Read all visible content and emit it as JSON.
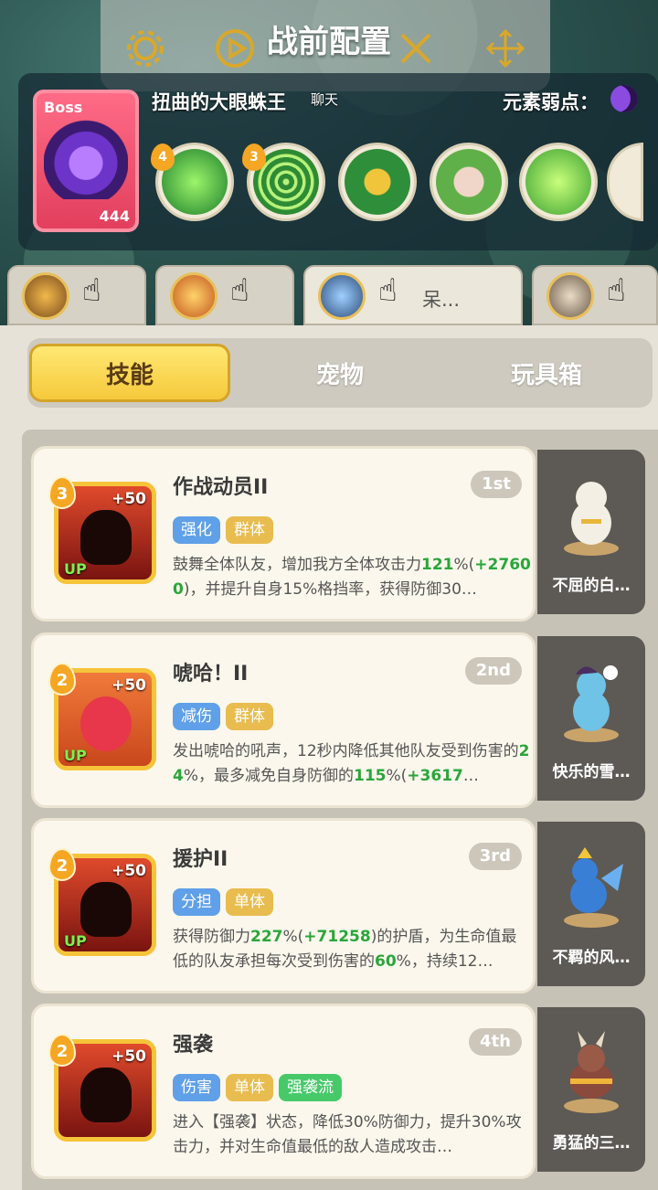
{
  "header": {
    "title": "战前配置"
  },
  "boss": {
    "tag": "Boss",
    "level": "444",
    "name": "扭曲的大眼蛛王",
    "chat_label": "聊天",
    "weakness_label": "元素弱点："
  },
  "boss_skills": [
    {
      "badge": "4",
      "icon": "green-claw-icon"
    },
    {
      "badge": "3",
      "icon": "spider-web-icon"
    },
    {
      "badge": "",
      "icon": "monster-face-icon"
    },
    {
      "badge": "",
      "icon": "boar-icon"
    },
    {
      "badge": "",
      "icon": "green-slime-icon"
    }
  ],
  "team": [
    {
      "name": ""
    },
    {
      "name": ""
    },
    {
      "name": "呆..."
    },
    {
      "name": ""
    }
  ],
  "tabs": [
    {
      "label": "技能",
      "active": true
    },
    {
      "label": "宠物",
      "active": false
    },
    {
      "label": "玩具箱",
      "active": false
    }
  ],
  "skills": [
    {
      "level": "3",
      "bonus": "+50",
      "up": "UP",
      "name": "作战动员II",
      "rank": "1st",
      "tags": [
        {
          "text": "强化",
          "color": "blue"
        },
        {
          "text": "群体",
          "color": "gold"
        }
      ],
      "desc": [
        {
          "t": "鼓舞全体队友，增加我方全体攻击力",
          "h": false
        },
        {
          "t": "121",
          "h": true
        },
        {
          "t": "%(",
          "h": false
        },
        {
          "t": "+27600",
          "h": true
        },
        {
          "t": ")，并提升自身15%格挡率，获得防御30…",
          "h": false
        }
      ],
      "pet": "不屈的白…"
    },
    {
      "level": "2",
      "bonus": "+50",
      "up": "UP",
      "name": "唬哈！II",
      "rank": "2nd",
      "tags": [
        {
          "text": "减伤",
          "color": "blue"
        },
        {
          "text": "群体",
          "color": "gold"
        }
      ],
      "desc": [
        {
          "t": "发出唬哈的吼声，12秒内降低其他队友受到伤害的",
          "h": false
        },
        {
          "t": "24",
          "h": true
        },
        {
          "t": "%，最多减免自身防御的",
          "h": false
        },
        {
          "t": "115",
          "h": true
        },
        {
          "t": "%(",
          "h": false
        },
        {
          "t": "+3617",
          "h": true
        },
        {
          "t": "…",
          "h": false
        }
      ],
      "pet": "快乐的雪…"
    },
    {
      "level": "2",
      "bonus": "+50",
      "up": "UP",
      "name": "援护II",
      "rank": "3rd",
      "tags": [
        {
          "text": "分担",
          "color": "blue"
        },
        {
          "text": "单体",
          "color": "gold"
        }
      ],
      "desc": [
        {
          "t": "获得防御力",
          "h": false
        },
        {
          "t": "227",
          "h": true
        },
        {
          "t": "%(",
          "h": false
        },
        {
          "t": "+71258",
          "h": true
        },
        {
          "t": ")的护盾，为生命值最低的队友承担每次受到伤害的",
          "h": false
        },
        {
          "t": "60",
          "h": true
        },
        {
          "t": "%，持续12…",
          "h": false
        }
      ],
      "pet": "不羁的风…"
    },
    {
      "level": "2",
      "bonus": "+50",
      "up": "",
      "name": "强袭",
      "rank": "4th",
      "tags": [
        {
          "text": "伤害",
          "color": "blue"
        },
        {
          "text": "单体",
          "color": "gold"
        },
        {
          "text": "强袭流",
          "color": "green"
        }
      ],
      "desc": [
        {
          "t": "进入【强袭】状态，降低30%防御力，提升30%攻击力，并对生命值最低的敌人造成攻击…",
          "h": false
        }
      ],
      "pet": "勇猛的三…"
    }
  ]
}
